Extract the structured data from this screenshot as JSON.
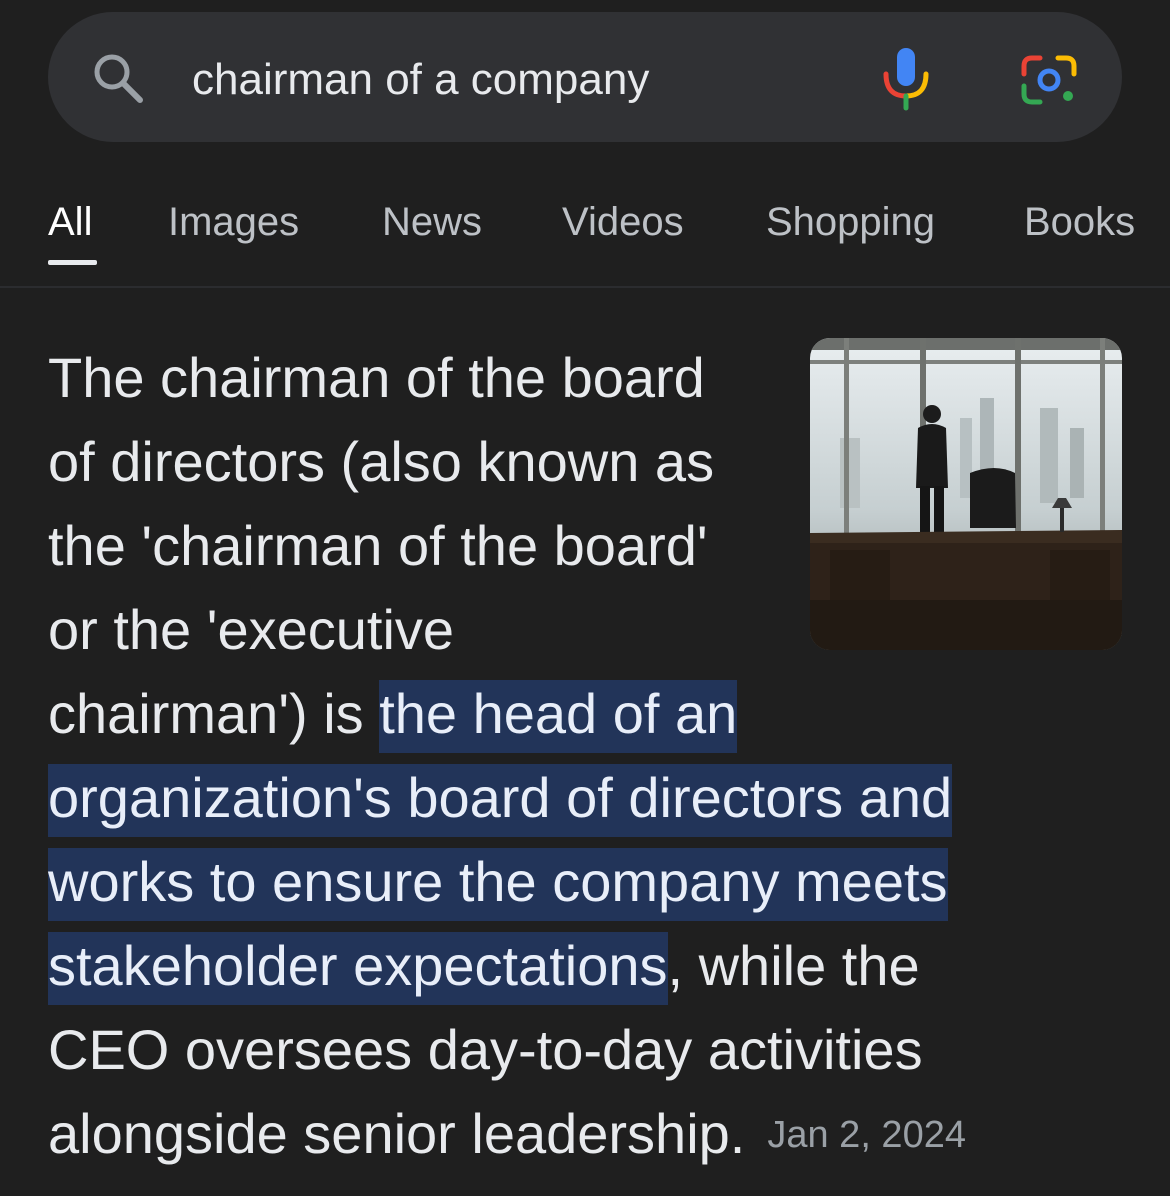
{
  "search": {
    "query": "chairman of a company",
    "icons": [
      "search-icon",
      "mic-icon",
      "lens-icon"
    ]
  },
  "tabs": [
    {
      "label": "All",
      "active": true
    },
    {
      "label": "Images",
      "active": false
    },
    {
      "label": "News",
      "active": false
    },
    {
      "label": "Videos",
      "active": false
    },
    {
      "label": "Shopping",
      "active": false
    },
    {
      "label": "Books",
      "active": false
    }
  ],
  "snippet": {
    "lines": [
      "The chairman of the board",
      "of directors (also known as",
      "the 'chairman of the board'",
      "or the 'executive"
    ],
    "line5_plain": "chairman') is ",
    "highlight_1": "the head of an",
    "highlight_2": "organization's board of directors and",
    "highlight_3": "works to ensure the company meets",
    "highlight_4": "stakeholder expectations",
    "after_highlight": ", while the",
    "line10": "CEO oversees day-to-day activities",
    "line11": "alongside senior leadership.",
    "date": "Jan 2, 2024"
  },
  "colors": {
    "background": "#1f1f1f",
    "search_bar": "#303134",
    "highlight": "#223459",
    "text": "#e8eaed",
    "muted": "#9aa0a6"
  }
}
